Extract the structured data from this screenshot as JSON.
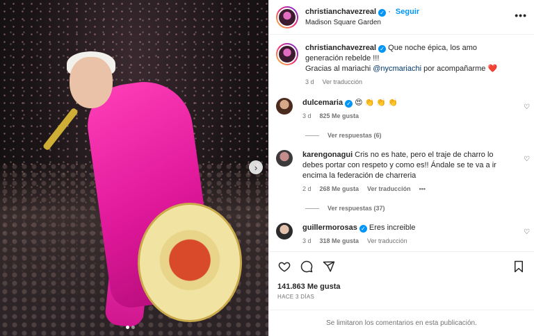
{
  "post": {
    "username": "christianchavezreal",
    "follow_label": "Seguir",
    "location": "Madison Square Garden",
    "more_label": "•••"
  },
  "caption": {
    "username": "christianchavezreal",
    "text_1": " Que noche épica, los amo generación rebelde !!!",
    "text_2a": "Gracias al mariachi ",
    "mention": "@nycmariachi",
    "text_2b": " por acompañarme ",
    "emoji": "❤️",
    "time": "3 d",
    "translate": "Ver traducción"
  },
  "comments": [
    {
      "username": "dulcemaria",
      "text": " 😍 👏 👏 👏",
      "time": "3 d",
      "likes": "825 Me gusta",
      "replies": "Ver respuestas (6)"
    },
    {
      "username": "karengonagui",
      "text": " Cris no es hate, pero el traje de charro lo debes portar con respeto y como es!! Ándale se te va a ir encima la federación de charreria",
      "time": "2 d",
      "likes": "268 Me gusta",
      "translate": "Ver traducción",
      "options": "•••",
      "replies": "Ver respuestas (37)"
    },
    {
      "username": "guillermorosas",
      "text": " Eres increible",
      "time": "3 d",
      "likes": "318 Me gusta",
      "translate": "Ver traducción"
    }
  ],
  "stats": {
    "likes": "141.863 Me gusta",
    "ago": "HACE 3 DÍAS"
  },
  "footer": {
    "limited": "Se limitaron los comentarios en esta publicación."
  },
  "icons": [
    "verified-icon",
    "heart-icon",
    "comment-icon",
    "share-icon",
    "save-icon",
    "more-icon",
    "chevron-right-icon"
  ],
  "colors": {
    "accent": "#0095f6",
    "text": "#262626",
    "muted": "#737373",
    "suit": "#ff3fb8"
  }
}
